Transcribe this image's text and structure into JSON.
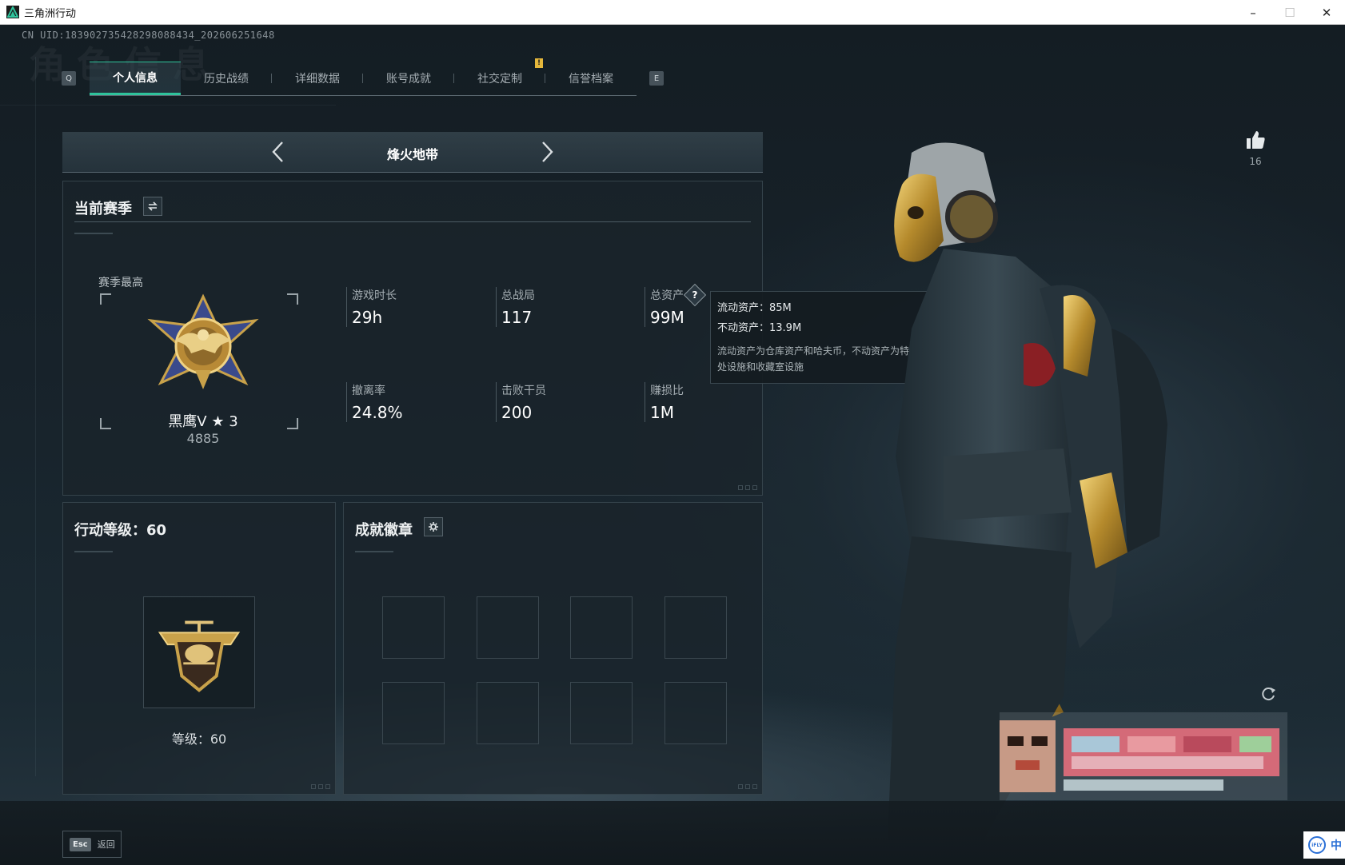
{
  "window": {
    "title": "三角洲行动",
    "minimize": "–",
    "maximize": "☐",
    "close": "✕"
  },
  "uid": "CN UID:183902735428298088434_202606251648",
  "watermark": "角色信息",
  "tabs": {
    "left_key": "Q",
    "right_key": "E",
    "items": [
      {
        "label": "个人信息",
        "active": true
      },
      {
        "label": "历史战绩",
        "active": false
      },
      {
        "label": "详细数据",
        "active": false
      },
      {
        "label": "账号成就",
        "active": false
      },
      {
        "label": "社交定制",
        "active": false
      },
      {
        "label": "信誉档案",
        "active": false
      }
    ],
    "alert": "!"
  },
  "mode": {
    "name": "烽火地带"
  },
  "season": {
    "title": "当前赛季",
    "highest_label": "赛季最高",
    "rank_name": "黑鹰V ★ 3",
    "rank_score": "4885",
    "stats": [
      {
        "label": "游戏时长",
        "value": "29h"
      },
      {
        "label": "总战局",
        "value": "117"
      },
      {
        "label": "总资产",
        "value": "99M"
      },
      {
        "label": "撤离率",
        "value": "24.8%"
      },
      {
        "label": "击败干员",
        "value": "200"
      },
      {
        "label": "赚损比",
        "value": "1M"
      }
    ],
    "help": "?"
  },
  "tooltip": {
    "liquid": "流动资产：85M",
    "fixed": "不动资产：13.9M",
    "note": "流动资产为仓库资产和哈夫币，不动资产为特勤处设施和收藏室设施"
  },
  "action_level": {
    "title": "行动等级：60",
    "level_text": "等级：60"
  },
  "achievements": {
    "title": "成就徽章",
    "slot_count": 8
  },
  "likes": {
    "count": "16"
  },
  "bottom": {
    "esc_key": "Esc",
    "esc_label": "返回"
  },
  "ime": {
    "logo": "iFLY",
    "char": "中"
  },
  "colors": {
    "accent": "#2fc39c",
    "alert": "#e5b73b",
    "gold": "#c9a24a"
  }
}
